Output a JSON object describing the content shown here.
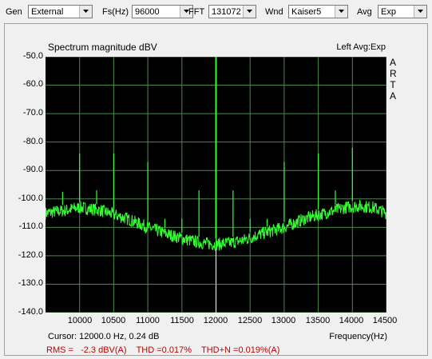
{
  "toolbar": {
    "gen_label": "Gen",
    "gen_value": "External",
    "fs_label": "Fs(Hz)",
    "fs_value": "96000",
    "fft_label": "FFT",
    "fft_value": "131072",
    "wnd_label": "Wnd",
    "wnd_value": "Kaiser5",
    "avg_label": "Avg",
    "avg_value": "Exp"
  },
  "plot": {
    "title": "Spectrum magnitude dBV",
    "channel_info": "Left  Avg:Exp",
    "watermark": [
      "A",
      "R",
      "T",
      "A"
    ],
    "cursor": "Cursor: 12000.0 Hz, 0.24 dB",
    "xaxis_label": "Frequency(Hz)",
    "stats": "RMS =   -2.3 dBV(A)    THD =0.017%    THD+N =0.019%(A)",
    "colors": {
      "background": "#000000",
      "grid": "#4a8a4a",
      "trace": "#33ff33",
      "cursor": "#ffffff",
      "stats": "#c00000"
    }
  },
  "chart_data": {
    "type": "line",
    "xlabel": "Frequency(Hz)",
    "ylabel": "",
    "xlim": [
      9500,
      14500
    ],
    "ylim": [
      -140,
      -50
    ],
    "yticks": [
      "-50.0",
      "-60.0",
      "-70.0",
      "-80.0",
      "-90.0",
      "-100.0",
      "-110.0",
      "-120.0",
      "-130.0",
      "-140.0"
    ],
    "xticks": [
      "10000",
      "10500",
      "11000",
      "11500",
      "12000",
      "12500",
      "13000",
      "13500",
      "14000",
      "14500"
    ],
    "noise_floor": {
      "x": [
        9500,
        9800,
        10000,
        10300,
        10700,
        11000,
        11300,
        11600,
        11800,
        12000,
        12200,
        12400,
        12700,
        13000,
        13300,
        13600,
        13900,
        14100,
        14300,
        14500
      ],
      "y": [
        -105,
        -104,
        -103,
        -104,
        -107,
        -110,
        -112.5,
        -114.5,
        -115.5,
        -116,
        -115.5,
        -114.5,
        -112,
        -110,
        -107,
        -105,
        -103,
        -102.5,
        -103,
        -105
      ]
    },
    "spikes": [
      {
        "x": 9750,
        "y": -97.5
      },
      {
        "x": 10000,
        "y": -84
      },
      {
        "x": 10250,
        "y": -97
      },
      {
        "x": 10500,
        "y": -84
      },
      {
        "x": 11000,
        "y": -87
      },
      {
        "x": 11250,
        "y": -107
      },
      {
        "x": 11500,
        "y": -107
      },
      {
        "x": 11750,
        "y": -97
      },
      {
        "x": 12000,
        "y": -50
      },
      {
        "x": 12250,
        "y": -97
      },
      {
        "x": 12500,
        "y": -107
      },
      {
        "x": 12750,
        "y": -107
      },
      {
        "x": 13000,
        "y": -87
      },
      {
        "x": 13500,
        "y": -84
      },
      {
        "x": 13750,
        "y": -97
      },
      {
        "x": 14000,
        "y": -82
      }
    ],
    "cursor_x": 12000
  }
}
